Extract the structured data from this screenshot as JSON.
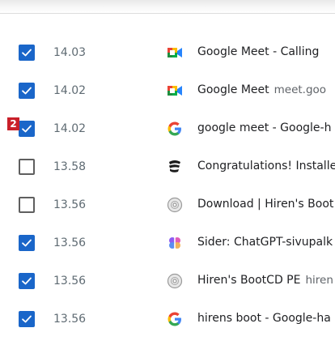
{
  "rows": [
    {
      "checked": true,
      "time": "14.03",
      "icon": "google-meet-icon",
      "title": "Google Meet - Calling",
      "url": ""
    },
    {
      "checked": true,
      "time": "14.02",
      "icon": "google-meet-icon",
      "title": "Google Meet",
      "url": "meet.goo"
    },
    {
      "checked": true,
      "time": "14.02",
      "icon": "google-icon",
      "title": "google meet - Google-h",
      "url": "",
      "badge": "2"
    },
    {
      "checked": false,
      "time": "13.58",
      "icon": "edge-install-icon",
      "title": "Congratulations! Installe",
      "url": ""
    },
    {
      "checked": false,
      "time": "13.56",
      "icon": "disc-icon",
      "title": "Download | Hiren's Boot",
      "url": ""
    },
    {
      "checked": true,
      "time": "13.56",
      "icon": "sider-icon",
      "title": "Sider: ChatGPT-sivupalk",
      "url": ""
    },
    {
      "checked": true,
      "time": "13.56",
      "icon": "disc-icon",
      "title": "Hiren's BootCD PE",
      "url": "hiren"
    },
    {
      "checked": true,
      "time": "13.56",
      "icon": "google-icon",
      "title": "hirens boot - Google-ha",
      "url": ""
    }
  ],
  "colors": {
    "checkbox_accent": "#1a66c9",
    "badge": "#c9202a"
  }
}
